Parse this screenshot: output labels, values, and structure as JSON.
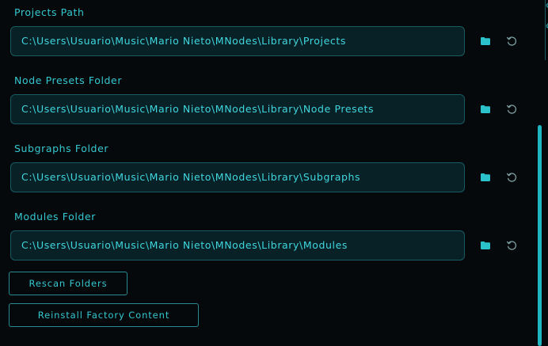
{
  "colors": {
    "accent": "#35c8d0",
    "field_bg": "#082126",
    "field_border": "#1a5a60",
    "background": "#05090b"
  },
  "folders": [
    {
      "label": "Projects Path",
      "value": "C:\\Users\\Usuario\\Music\\Mario Nieto\\MNodes\\Library\\Projects"
    },
    {
      "label": "Node Presets Folder",
      "value": "C:\\Users\\Usuario\\Music\\Mario Nieto\\MNodes\\Library\\Node Presets"
    },
    {
      "label": "Subgraphs Folder",
      "value": "C:\\Users\\Usuario\\Music\\Mario Nieto\\MNodes\\Library\\Subgraphs"
    },
    {
      "label": "Modules Folder",
      "value": "C:\\Users\\Usuario\\Music\\Mario Nieto\\MNodes\\Library\\Modules"
    }
  ],
  "icons": {
    "browse": "folder-icon",
    "reset": "reset-icon"
  },
  "buttons": {
    "rescan": "Rescan Folders",
    "reinstall": "Reinstall Factory Content"
  },
  "edge_glyphs": [
    "¢",
    "¢"
  ]
}
